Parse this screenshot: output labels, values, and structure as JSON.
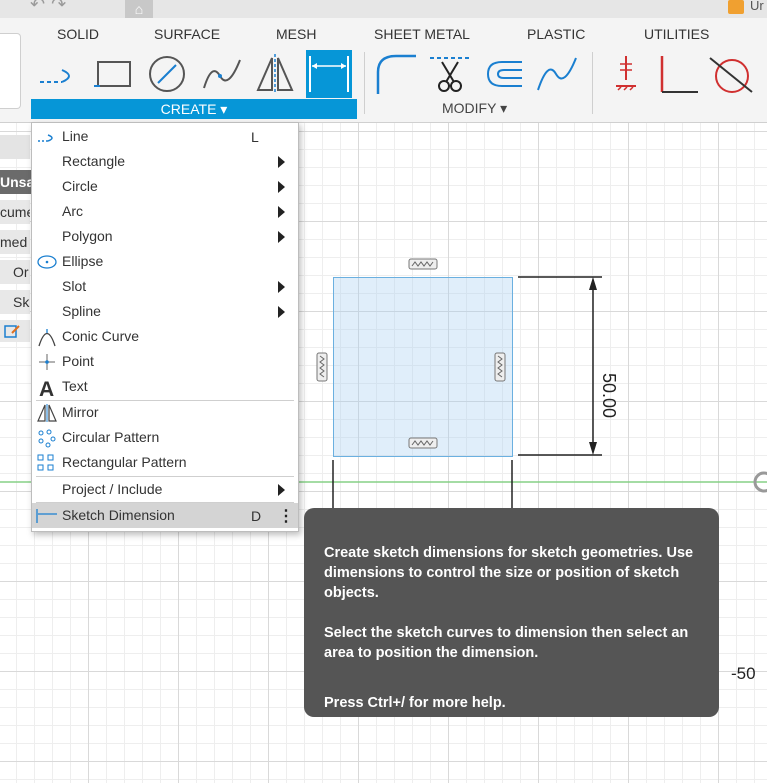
{
  "window": {
    "doc_name_partial": "Ur"
  },
  "tabs": [
    "SOLID",
    "SURFACE",
    "MESH",
    "SHEET METAL",
    "PLASTIC",
    "UTILITIES"
  ],
  "toolbar": {
    "create_label": "CREATE ▾",
    "modify_label": "MODIFY ▾",
    "create_tools": [
      "line-icon",
      "rectangle-icon",
      "circle-icon",
      "spline-icon",
      "mirror-icon",
      "sketch-dimension-icon"
    ],
    "modify_tools": [
      "fillet-icon",
      "trim-icon",
      "offset-icon",
      "extend-icon"
    ],
    "constraint_tools": [
      "hatch-icon",
      "perpendicular-icon",
      "tangent-icon"
    ]
  },
  "browser_fragments": [
    "Unsa",
    "cume",
    "med",
    "Or",
    "Sk"
  ],
  "create_menu": {
    "items": [
      {
        "label": "Line",
        "shortcut": "L",
        "icon": "line-icon"
      },
      {
        "label": "Rectangle",
        "submenu": true
      },
      {
        "label": "Circle",
        "submenu": true
      },
      {
        "label": "Arc",
        "submenu": true
      },
      {
        "label": "Polygon",
        "submenu": true
      },
      {
        "label": "Ellipse",
        "icon": "ellipse-icon"
      },
      {
        "label": "Slot",
        "submenu": true
      },
      {
        "label": "Spline",
        "submenu": true
      },
      {
        "label": "Conic Curve",
        "icon": "conic-curve-icon"
      },
      {
        "label": "Point",
        "icon": "point-icon"
      },
      {
        "label": "Text",
        "icon": "text-icon"
      },
      {
        "label": "Mirror",
        "icon": "mirror-icon"
      },
      {
        "label": "Circular Pattern",
        "icon": "circular-pattern-icon"
      },
      {
        "label": "Rectangular Pattern",
        "icon": "rectangular-pattern-icon"
      },
      {
        "label": "Project / Include",
        "submenu": true
      },
      {
        "label": "Sketch Dimension",
        "shortcut": "D",
        "icon": "sketch-dimension-icon",
        "highlighted": true
      }
    ]
  },
  "tooltip": {
    "p1": "Create sketch dimensions for sketch geometries. Use dimensions to control the size or position of sketch objects.",
    "p2": "Select the sketch curves to dimension then select an area to position the dimension.",
    "p3": "Press Ctrl+/ for more help."
  },
  "canvas": {
    "dimension_value": "50.00",
    "axis_label": "-50"
  },
  "colors": {
    "accent": "#0696d7",
    "sketch_fill": "#a5cdf0",
    "sketch_line": "#6bb0e0",
    "tooltip_bg": "#555555",
    "axis_green": "#7fd07f",
    "tool_red": "#d03030"
  }
}
